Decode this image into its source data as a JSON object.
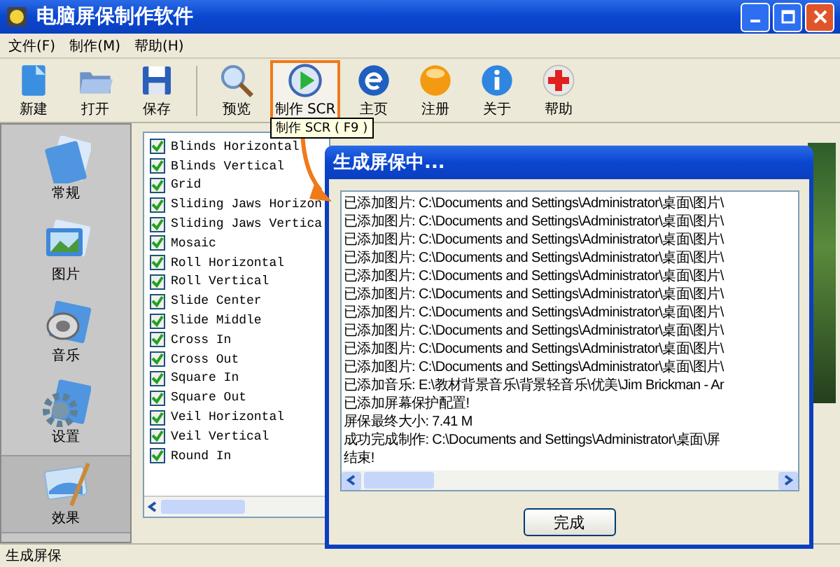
{
  "window": {
    "title": "电脑屏保制作软件"
  },
  "menu": [
    "文件(F)",
    "制作(M)",
    "帮助(H)"
  ],
  "toolbar": [
    {
      "label": "新建",
      "highlighted": false
    },
    {
      "label": "打开",
      "highlighted": false
    },
    {
      "label": "保存",
      "highlighted": false
    },
    {
      "label": "预览",
      "highlighted": false
    },
    {
      "label": "制作 SCR",
      "highlighted": true
    },
    {
      "label": "主页",
      "highlighted": false
    },
    {
      "label": "注册",
      "highlighted": false
    },
    {
      "label": "关于",
      "highlighted": false
    },
    {
      "label": "帮助",
      "highlighted": false
    }
  ],
  "tooltip": "制作 SCR ( F9 )",
  "sidebar": {
    "items": [
      {
        "label": "常规",
        "selected": false
      },
      {
        "label": "图片",
        "selected": false
      },
      {
        "label": "音乐",
        "selected": false
      },
      {
        "label": "设置",
        "selected": false
      },
      {
        "label": "效果",
        "selected": true
      }
    ]
  },
  "effects": [
    {
      "label": "Blinds Horizontal",
      "checked": true
    },
    {
      "label": "Blinds Vertical",
      "checked": true
    },
    {
      "label": "Grid",
      "checked": true
    },
    {
      "label": "Sliding Jaws Horizon",
      "checked": true
    },
    {
      "label": "Sliding Jaws Vertica",
      "checked": true
    },
    {
      "label": "Mosaic",
      "checked": true
    },
    {
      "label": "Roll Horizontal",
      "checked": true
    },
    {
      "label": "Roll Vertical",
      "checked": true
    },
    {
      "label": "Slide Center",
      "checked": true
    },
    {
      "label": "Slide Middle",
      "checked": true
    },
    {
      "label": "Cross In",
      "checked": true
    },
    {
      "label": "Cross Out",
      "checked": true
    },
    {
      "label": "Square In",
      "checked": true
    },
    {
      "label": "Square Out",
      "checked": true
    },
    {
      "label": "Veil Horizontal",
      "checked": true
    },
    {
      "label": "Veil Vertical",
      "checked": true
    },
    {
      "label": "Round In",
      "checked": true
    }
  ],
  "dialog": {
    "title": "生成屏保中...",
    "log": [
      "已添加图片: C:\\Documents and Settings\\Administrator\\桌面\\图片\\",
      "已添加图片: C:\\Documents and Settings\\Administrator\\桌面\\图片\\",
      "已添加图片: C:\\Documents and Settings\\Administrator\\桌面\\图片\\",
      "已添加图片: C:\\Documents and Settings\\Administrator\\桌面\\图片\\",
      "已添加图片: C:\\Documents and Settings\\Administrator\\桌面\\图片\\",
      "已添加图片: C:\\Documents and Settings\\Administrator\\桌面\\图片\\",
      "已添加图片: C:\\Documents and Settings\\Administrator\\桌面\\图片\\",
      "已添加图片: C:\\Documents and Settings\\Administrator\\桌面\\图片\\",
      "已添加图片: C:\\Documents and Settings\\Administrator\\桌面\\图片\\",
      "已添加图片: C:\\Documents and Settings\\Administrator\\桌面\\图片\\",
      "已添加音乐: E:\\教材背景音乐\\背景轻音乐\\优美\\Jim Brickman - Ar",
      "已添加屏幕保护配置!",
      "屏保最终大小: 7.41 M",
      "成功完成制作: C:\\Documents and Settings\\Administrator\\桌面\\屏",
      "结束!"
    ],
    "button": "完成"
  },
  "status_bar": "生成屏保"
}
